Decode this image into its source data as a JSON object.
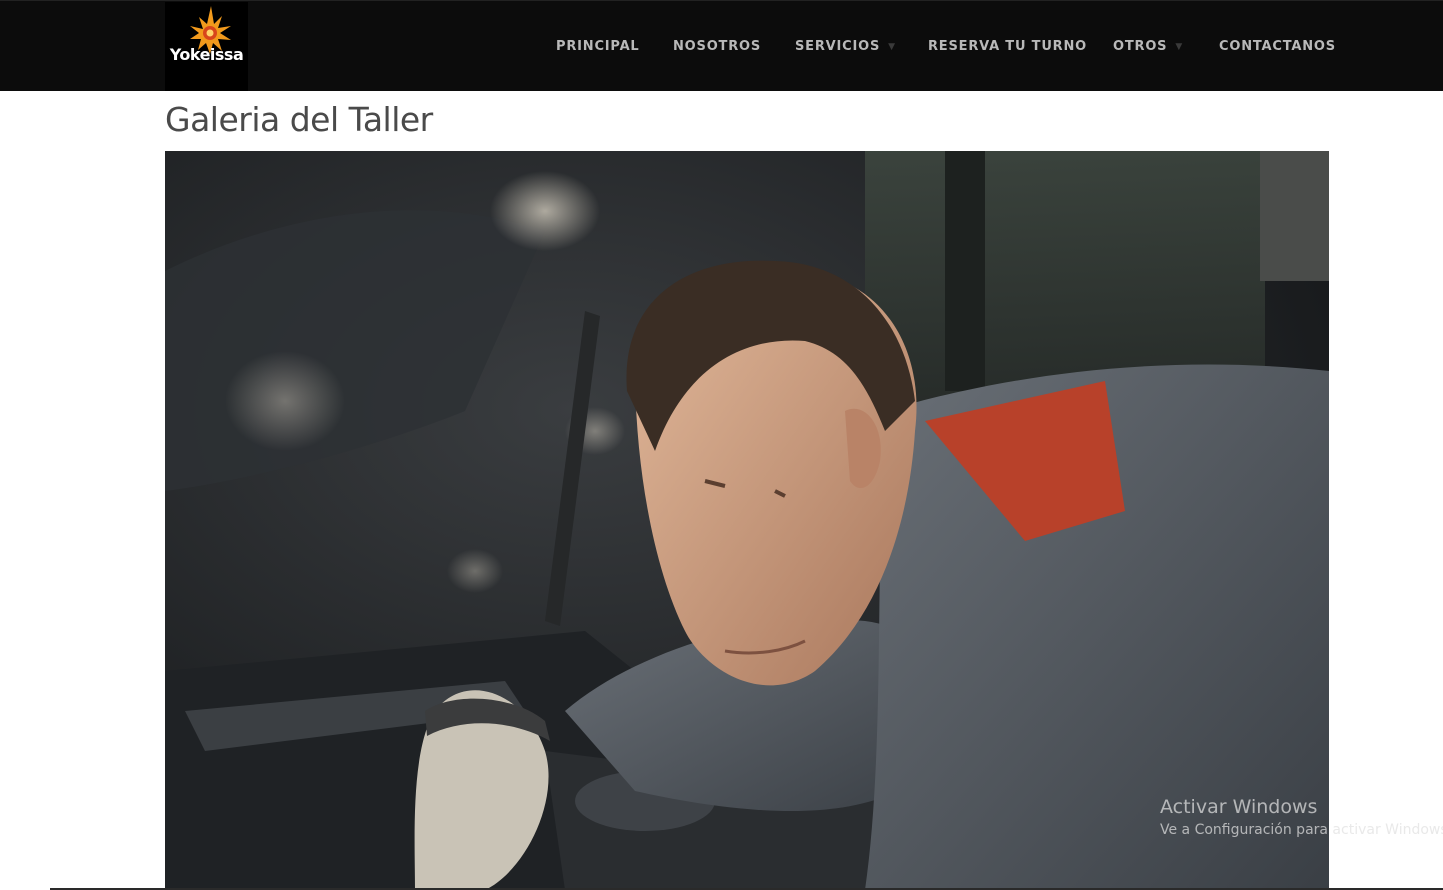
{
  "brand": {
    "logo_text": "Yokeissa",
    "accent_color": "#f0a020"
  },
  "nav": {
    "items": [
      {
        "label": "PRINCIPAL",
        "has_dropdown": false
      },
      {
        "label": "NOSOTROS",
        "has_dropdown": false
      },
      {
        "label": "SERVICIOS",
        "has_dropdown": true
      },
      {
        "label": "RESERVA TU TURNO",
        "has_dropdown": false
      },
      {
        "label": "OTROS",
        "has_dropdown": true
      },
      {
        "label": "CONTACTANOS",
        "has_dropdown": false
      }
    ],
    "dropdown_icon": "chevron-down-icon"
  },
  "page": {
    "title": "Galeria del Taller"
  },
  "gallery": {
    "image_icon": "photo-mechanic-icon"
  },
  "os_watermark": {
    "title": "Activar Windows",
    "subtitle": "Ve a Configuración para activar Windows."
  }
}
